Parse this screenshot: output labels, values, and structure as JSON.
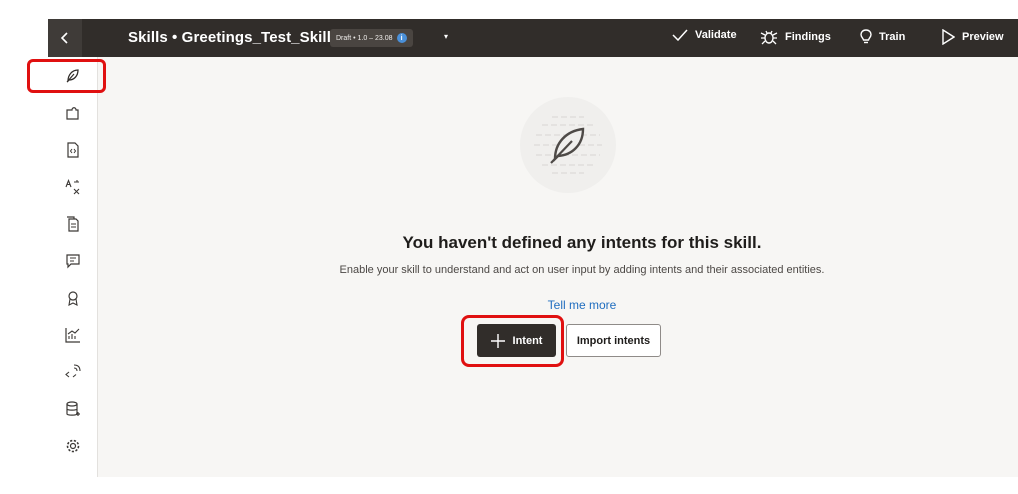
{
  "topbar": {
    "title": "Skills • Greetings_Test_Skill",
    "version_badge": "Draft • 1.0 – 23.08",
    "actions": [
      {
        "label": "Validate",
        "icon": "check-icon"
      },
      {
        "label": "Findings",
        "icon": "bug-icon"
      },
      {
        "label": "Train",
        "icon": "lightbulb-icon"
      },
      {
        "label": "Preview",
        "icon": "play-icon"
      }
    ]
  },
  "sidebar": {
    "items": [
      {
        "name": "intents",
        "icon": "feather-icon",
        "active": true
      },
      {
        "name": "entities",
        "icon": "puzzle-icon"
      },
      {
        "name": "components",
        "icon": "code-file-icon"
      },
      {
        "name": "resource-bundles",
        "icon": "translate-icon"
      },
      {
        "name": "documents",
        "icon": "documents-icon"
      },
      {
        "name": "conversation-designer",
        "icon": "chat-icon"
      },
      {
        "name": "quality",
        "icon": "badge-icon"
      },
      {
        "name": "insights",
        "icon": "chart-icon"
      },
      {
        "name": "flows",
        "icon": "flow-icon"
      },
      {
        "name": "datasets",
        "icon": "database-icon"
      },
      {
        "name": "settings",
        "icon": "gear-icon"
      }
    ]
  },
  "main": {
    "empty_heading": "You haven't defined any intents for this skill.",
    "empty_description": "Enable your skill to understand and act on user input by adding intents and their associated entities.",
    "tell_me_more": "Tell me more",
    "intent_button": "Intent",
    "import_button": "Import intents"
  },
  "colors": {
    "topbar": "#312d2a",
    "highlight": "#e01010",
    "link": "#1f6dbf",
    "primary_button": "#312d2a"
  }
}
